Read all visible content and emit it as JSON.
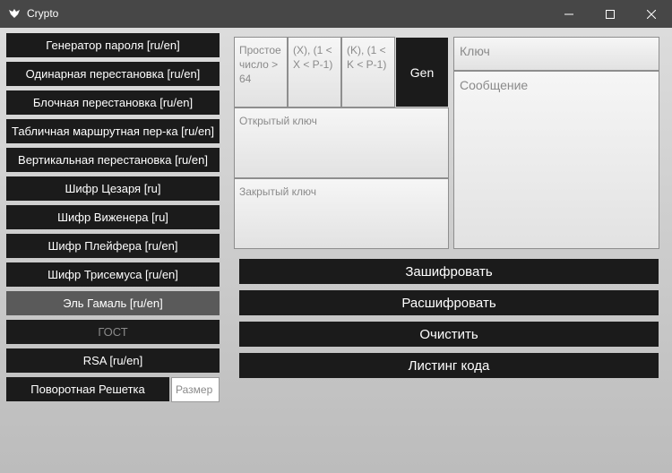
{
  "window": {
    "title": "Crypto"
  },
  "sidebar": {
    "items": [
      {
        "label": "Генератор пароля [ru/en]"
      },
      {
        "label": "Одинарная перестановка [ru/en]"
      },
      {
        "label": "Блочная перестановка [ru/en]"
      },
      {
        "label": "Табличная маршрутная пер-ка [ru/en]"
      },
      {
        "label": "Вертикальная перестановка [ru/en]"
      },
      {
        "label": "Шифр Цезаря [ru]"
      },
      {
        "label": "Шифр Виженера [ru]"
      },
      {
        "label": "Шифр Плейфера [ru/en]"
      },
      {
        "label": "Шифр Трисемуса [ru/en]"
      },
      {
        "label": "Эль Гамаль [ru/en]",
        "state": "selected"
      },
      {
        "label": "ГОСТ",
        "state": "disabled"
      },
      {
        "label": "RSA [ru/en]"
      },
      {
        "label": "Поворотная Решетка"
      }
    ],
    "size_input": {
      "placeholder": "Размер"
    }
  },
  "params": {
    "prime_placeholder": "Простое число > 64",
    "x_placeholder": "(X), (1 < X < P-1)",
    "k_placeholder": "(K), (1 < K < P-1)",
    "gen_label": "Gen",
    "public_key_placeholder": "Открытый ключ",
    "private_key_placeholder": "Закрытый ключ"
  },
  "right": {
    "key_placeholder": "Ключ",
    "message_placeholder": "Сообщение"
  },
  "actions": {
    "encrypt": "Зашифровать",
    "decrypt": "Расшифровать",
    "clear": "Очистить",
    "listing": "Листинг кода"
  },
  "colors": {
    "titlebar": "#474747",
    "button": "#1b1b1b",
    "button_selected": "#5a5a5a",
    "background": "#c8c8c8"
  }
}
